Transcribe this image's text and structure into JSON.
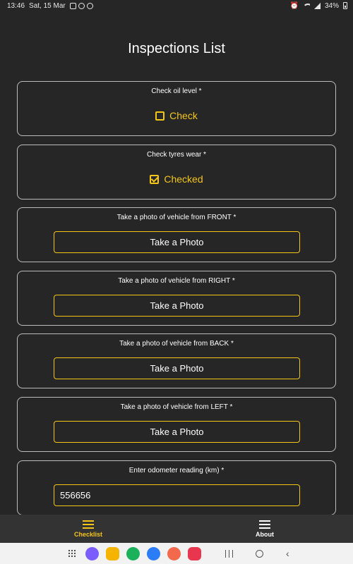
{
  "status_bar": {
    "time": "13:46",
    "date": "Sat, 15 Mar",
    "battery": "34%"
  },
  "header": {
    "title": "Inspections List"
  },
  "cards": {
    "oil": {
      "label": "Check oil level *",
      "checkbox_label": "Check",
      "checked": false
    },
    "tyres": {
      "label": "Check tyres wear *",
      "checkbox_label": "Checked",
      "checked": true
    },
    "front": {
      "label": "Take a photo of vehicle from FRONT *",
      "button_label": "Take a Photo"
    },
    "right": {
      "label": "Take a photo of vehicle from RIGHT *",
      "button_label": "Take a Photo"
    },
    "back": {
      "label": "Take a photo of vehicle from BACK *",
      "button_label": "Take a Photo"
    },
    "left": {
      "label": "Take a photo of vehicle from LEFT *",
      "button_label": "Take a Photo"
    },
    "odometer": {
      "label": "Enter odometer reading (km) *",
      "value": "556656"
    }
  },
  "bottom_nav": {
    "items": [
      {
        "label": "Checklist",
        "icon": "list-icon",
        "active": true
      },
      {
        "label": "About",
        "icon": "menu-icon",
        "active": false
      }
    ]
  },
  "colors": {
    "accent": "#f5c518",
    "background": "#262626",
    "card_border": "#bdbdbd",
    "nav_background": "#333333"
  },
  "dock_apps": [
    {
      "name": "galaxy-store-icon",
      "color": "#7b5cff"
    },
    {
      "name": "my-files-icon",
      "color": "#f5b400"
    },
    {
      "name": "call-app-icon",
      "color": "#1bb05a"
    },
    {
      "name": "messages-icon",
      "color": "#2a7df6"
    },
    {
      "name": "contacts-icon",
      "color": "#f26a4b"
    },
    {
      "name": "screen-recorder-icon",
      "color": "#e8364f"
    }
  ]
}
